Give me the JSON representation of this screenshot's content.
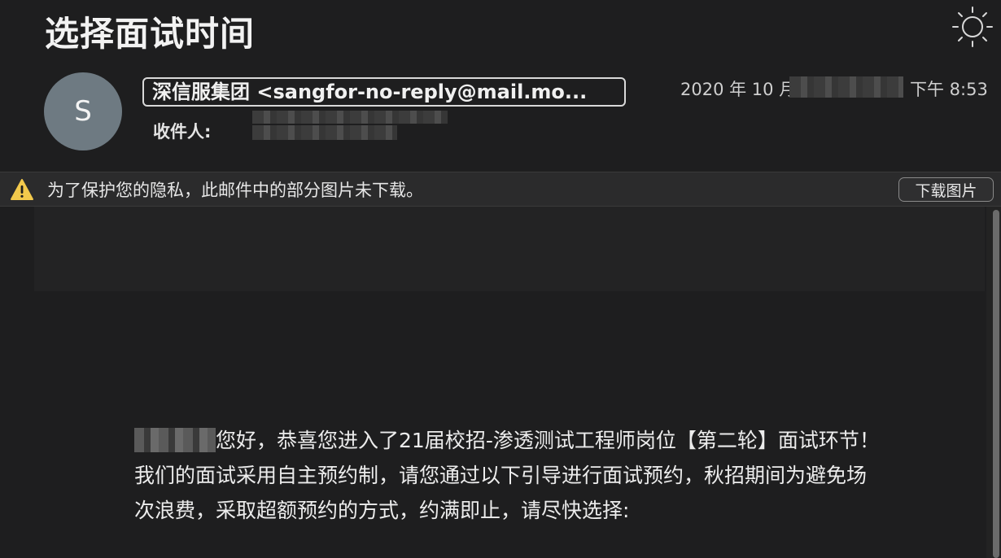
{
  "email": {
    "subject": "选择面试时间",
    "sender": {
      "initial": "S",
      "display": "深信服集团 <sangfor-no-reply@mail.mo..."
    },
    "recipient_label": "收件人:",
    "date_year": "2020 年 10 月",
    "date_time": "下午 8:53"
  },
  "privacy_banner": {
    "message": "为了保护您的隐私，此邮件中的部分图片未下载。",
    "button_label": "下载图片"
  },
  "body": {
    "greeting_rest": "您好，恭喜您进入了21届校招-渗透测试工程师岗位【第二轮】面试环节！",
    "paragraph_2": "我们的面试采用自主预约制，请您通过以下引导进行面试预约，秋招期间为避免场次浪费，采取超额预约的方式，约满即止，请尽快选择:"
  },
  "icons": {
    "theme": "sun-icon",
    "warning": "warning-icon"
  },
  "colors": {
    "background": "#1e1e1f",
    "avatar": "#6e7a82",
    "warning": "#f2c94c"
  }
}
